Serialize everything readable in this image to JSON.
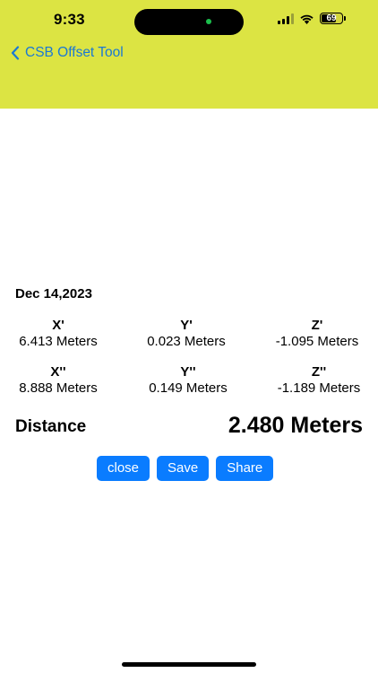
{
  "status_bar": {
    "time": "9:33",
    "battery": "69"
  },
  "nav": {
    "back_label": "CSB Offset Tool"
  },
  "colors": {
    "header_bg": "#dce443",
    "accent": "#1a78d4",
    "button_bg": "#0a7cff"
  },
  "result": {
    "date": "Dec 14,2023",
    "primary": [
      {
        "label": "X'",
        "value": "6.413 Meters"
      },
      {
        "label": "Y'",
        "value": "0.023 Meters"
      },
      {
        "label": "Z'",
        "value": "-1.095 Meters"
      }
    ],
    "secondary": [
      {
        "label": "X''",
        "value": "8.888 Meters"
      },
      {
        "label": "Y''",
        "value": "0.149 Meters"
      },
      {
        "label": "Z''",
        "value": "-1.189 Meters"
      }
    ],
    "distance_label": "Distance",
    "distance_value": "2.480 Meters"
  },
  "actions": {
    "close": "close",
    "save": "Save",
    "share": "Share"
  }
}
